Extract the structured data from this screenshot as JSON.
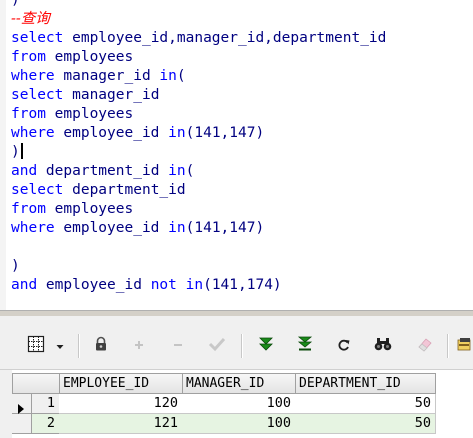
{
  "editor": {
    "lines": [
      {
        "segments": [
          {
            "t": "pun",
            "v": ")"
          }
        ]
      },
      {
        "segments": [
          {
            "t": "cmt",
            "v": "--查询"
          }
        ]
      },
      {
        "segments": [
          {
            "t": "kw",
            "v": "select"
          },
          {
            "t": "id",
            "v": " employee_id,manager_id,department_id"
          }
        ]
      },
      {
        "segments": [
          {
            "t": "kw",
            "v": "from"
          },
          {
            "t": "id",
            "v": " employees"
          }
        ]
      },
      {
        "segments": [
          {
            "t": "kw",
            "v": "where"
          },
          {
            "t": "id",
            "v": " manager_id "
          },
          {
            "t": "kw",
            "v": "in"
          },
          {
            "t": "pun",
            "v": "("
          }
        ]
      },
      {
        "segments": [
          {
            "t": "kw",
            "v": "select"
          },
          {
            "t": "id",
            "v": " manager_id"
          }
        ]
      },
      {
        "segments": [
          {
            "t": "kw",
            "v": "from"
          },
          {
            "t": "id",
            "v": " employees"
          }
        ]
      },
      {
        "segments": [
          {
            "t": "kw",
            "v": "where"
          },
          {
            "t": "id",
            "v": " employee_id "
          },
          {
            "t": "kw",
            "v": "in"
          },
          {
            "t": "pun",
            "v": "(141,147)"
          }
        ]
      },
      {
        "segments": [
          {
            "t": "pun",
            "v": ")"
          }
        ],
        "caret": true
      },
      {
        "segments": [
          {
            "t": "kw",
            "v": "and"
          },
          {
            "t": "id",
            "v": " department_id "
          },
          {
            "t": "kw",
            "v": "in"
          },
          {
            "t": "pun",
            "v": "("
          }
        ]
      },
      {
        "segments": [
          {
            "t": "kw",
            "v": "select"
          },
          {
            "t": "id",
            "v": " department_id"
          }
        ]
      },
      {
        "segments": [
          {
            "t": "kw",
            "v": "from"
          },
          {
            "t": "id",
            "v": " employees"
          }
        ]
      },
      {
        "segments": [
          {
            "t": "kw",
            "v": "where"
          },
          {
            "t": "id",
            "v": " employee_id "
          },
          {
            "t": "kw",
            "v": "in"
          },
          {
            "t": "pun",
            "v": "(141,147)"
          }
        ]
      },
      {
        "segments": []
      },
      {
        "segments": [
          {
            "t": "pun",
            "v": ")"
          }
        ]
      },
      {
        "segments": [
          {
            "t": "kw",
            "v": "and"
          },
          {
            "t": "id",
            "v": " employee_id "
          },
          {
            "t": "kw",
            "v": "not in"
          },
          {
            "t": "pun",
            "v": "(141,174)"
          }
        ]
      }
    ]
  },
  "toolbar": {
    "buttons": [
      {
        "name": "grid-view-button",
        "icon": "grid-icon",
        "enabled": true
      },
      {
        "name": "grid-view-dropdown",
        "icon": "chevron-down-icon",
        "enabled": true
      },
      {
        "name": "lock-button",
        "icon": "lock-icon",
        "enabled": true
      },
      {
        "name": "insert-record-button",
        "icon": "plus-icon",
        "enabled": false
      },
      {
        "name": "delete-record-button",
        "icon": "minus-icon",
        "enabled": false
      },
      {
        "name": "post-changes-button",
        "icon": "check-icon",
        "enabled": false
      },
      {
        "name": "fetch-next-page-button",
        "icon": "double-chevron-down-icon",
        "enabled": true
      },
      {
        "name": "fetch-last-page-button",
        "icon": "fetch-last-icon",
        "enabled": true
      },
      {
        "name": "refresh-button",
        "icon": "refresh-icon",
        "enabled": true
      },
      {
        "name": "find-button",
        "icon": "binoculars-icon",
        "enabled": true
      },
      {
        "name": "clear-button",
        "icon": "eraser-icon",
        "enabled": false
      },
      {
        "name": "export-button",
        "icon": "export-icon",
        "enabled": true
      }
    ]
  },
  "grid": {
    "columns": [
      "EMPLOYEE_ID",
      "MANAGER_ID",
      "DEPARTMENT_ID"
    ],
    "rows": [
      {
        "num": "1",
        "cells": [
          "120",
          "100",
          "50"
        ],
        "current": true
      },
      {
        "num": "2",
        "cells": [
          "121",
          "100",
          "50"
        ],
        "current": false
      }
    ],
    "colors": {
      "row_even": "#ffffff",
      "row_odd": "#e6f4e2",
      "header_bg": "#ececec"
    }
  }
}
